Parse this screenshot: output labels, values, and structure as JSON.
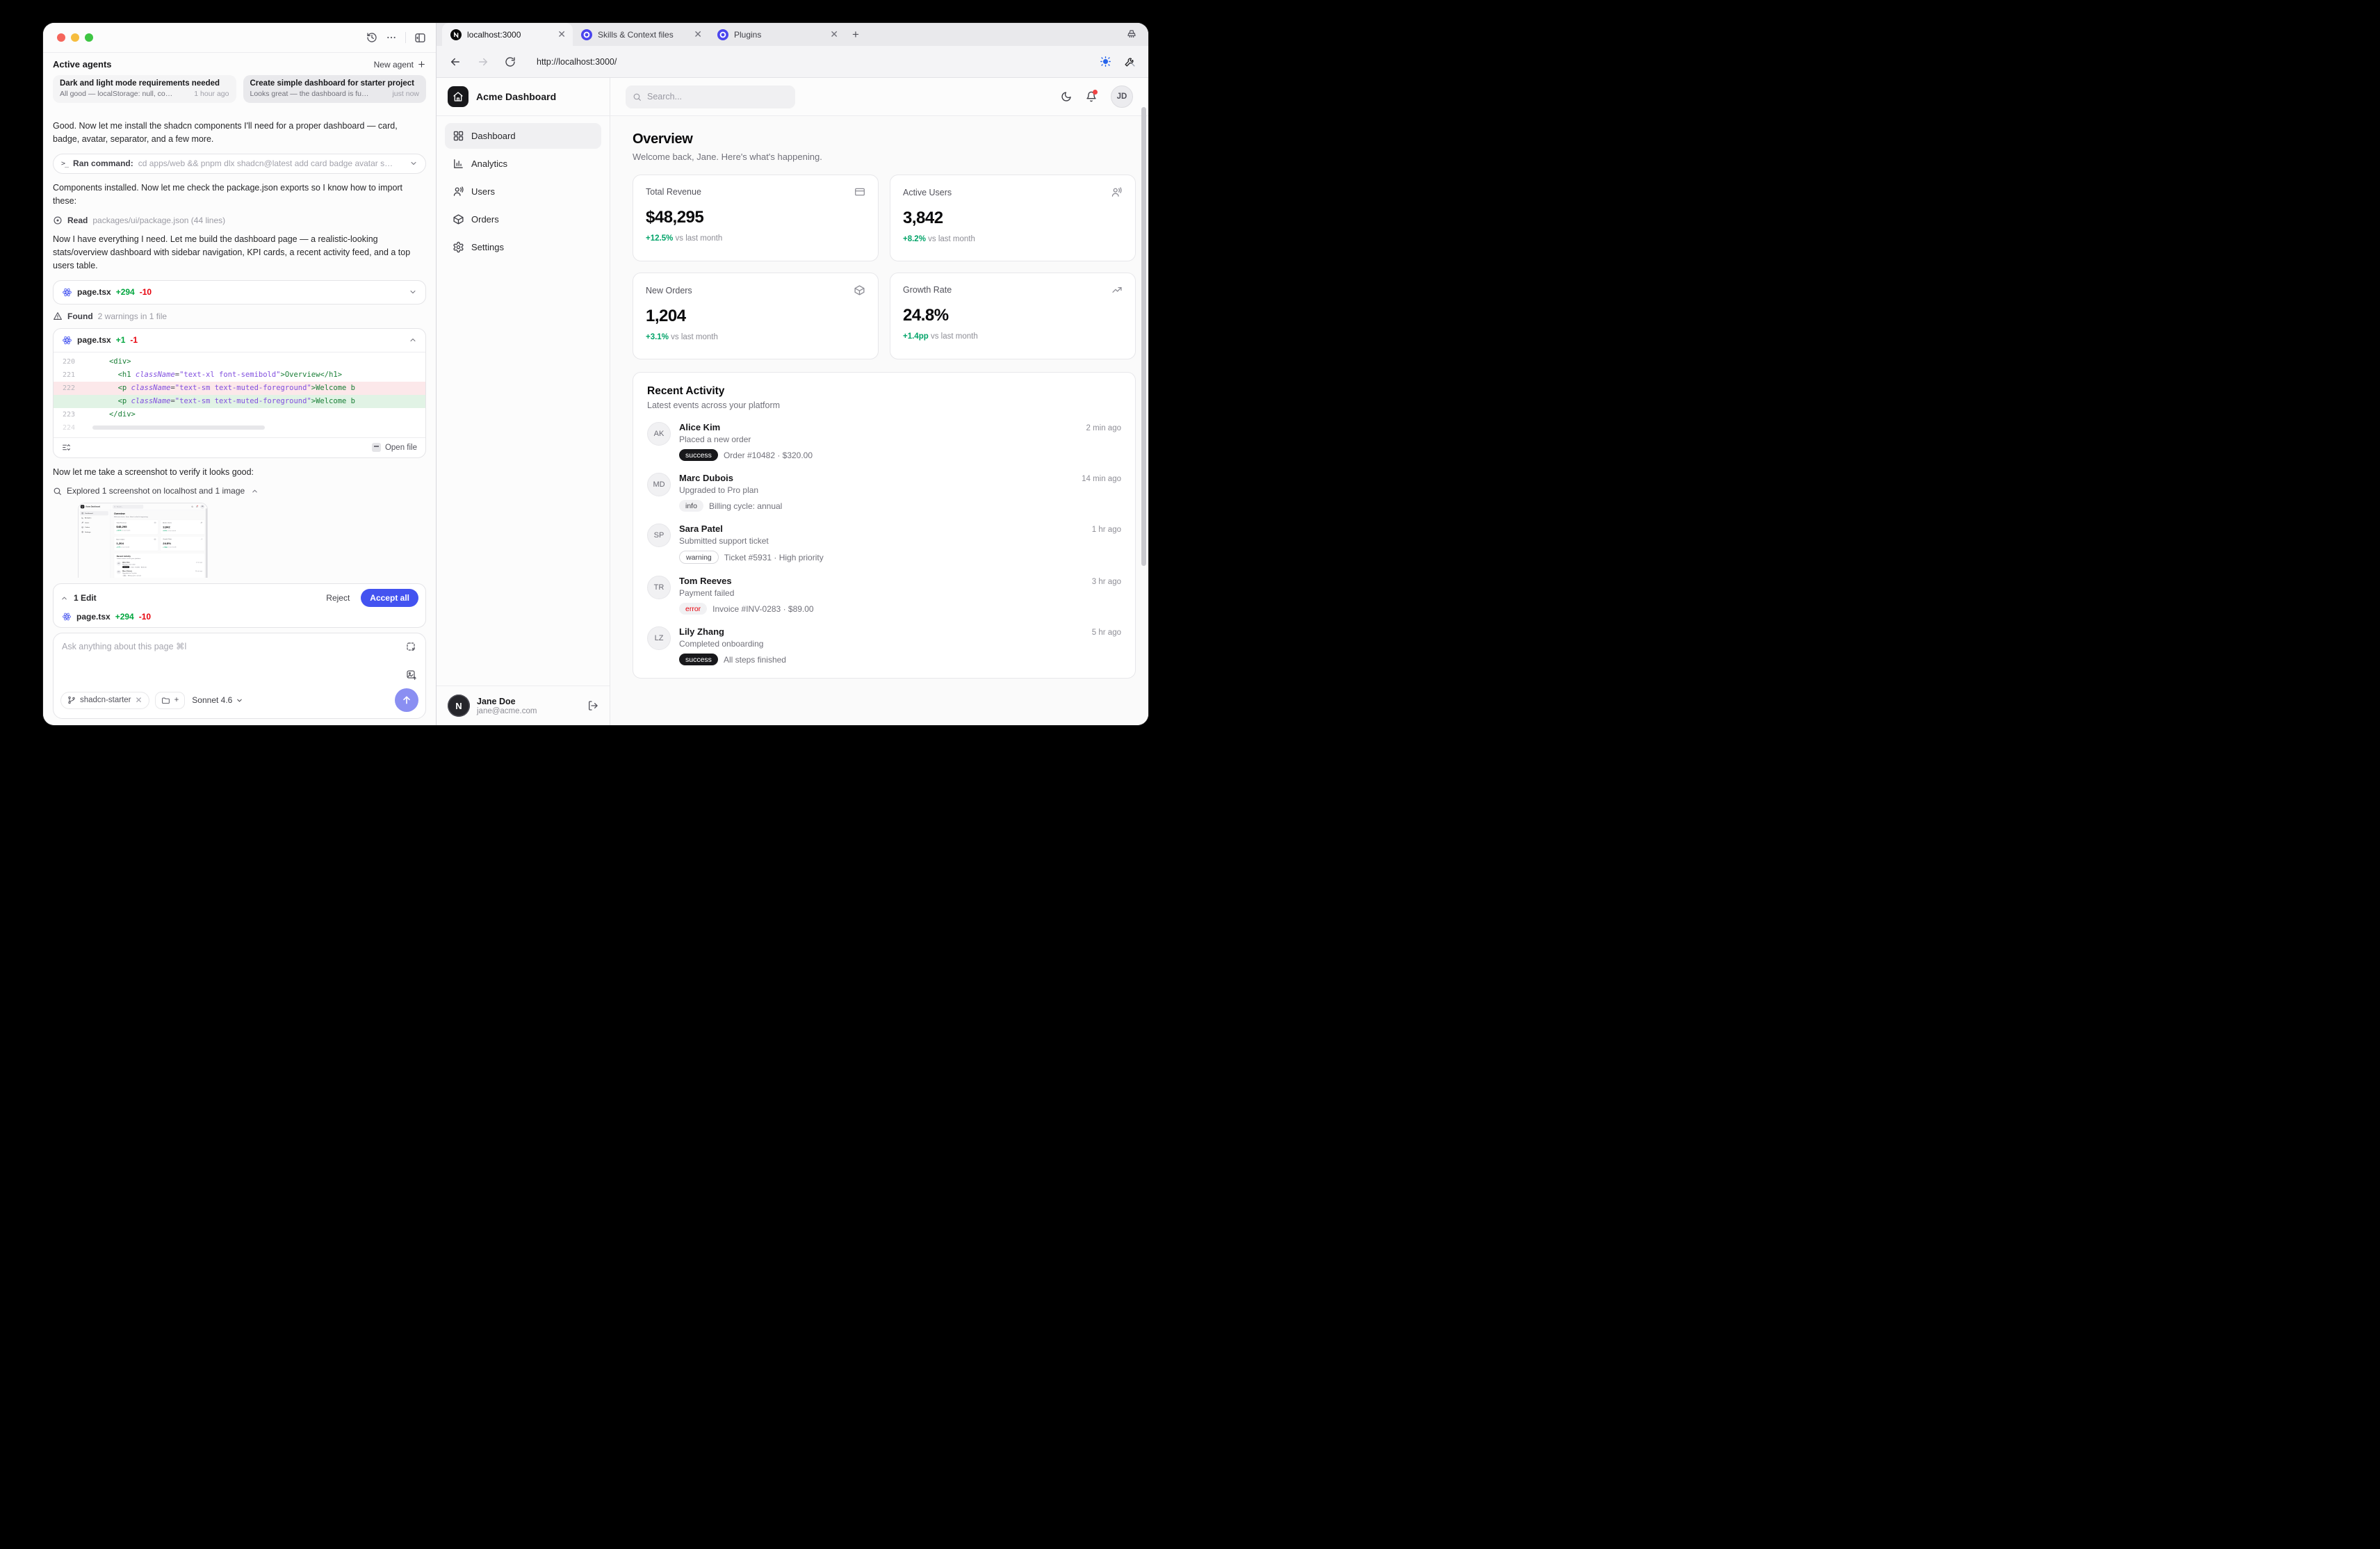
{
  "colors": {
    "accent_blue": "#4353f0",
    "positive_green": "#00a368",
    "diff_add_green": "#00a63e",
    "negative_red": "#e7000b",
    "send_periwinkle": "#8a8ff2",
    "favicon_indigo": "#4b45ee",
    "badge_dark": "#18181b"
  },
  "chat_panel": {
    "agents_header": {
      "title": "Active agents",
      "new_agent_label": "New agent",
      "plus": "+"
    },
    "agents": [
      {
        "title": "Dark and light mode requirements needed",
        "subtitle": "All good — localStorage: null, co…",
        "time": "1 hour ago",
        "state": ""
      },
      {
        "title": "Create simple dashboard for starter project",
        "subtitle": "Looks great — the dashboard is fu…",
        "time": "just now",
        "state": "selected"
      }
    ],
    "messages": {
      "m1": "Good. Now let me install the shadcn components I'll need for a proper dashboard — card, badge, avatar, separator, and a few more.",
      "m2": "Components installed. Now let me check the package.json exports so I know how to import these:",
      "m3": "Now I have everything I need. Let me build the dashboard page — a realistic-looking stats/overview dashboard with sidebar navigation, KPI cards, a recent activity feed, and a top users table.",
      "m4": "Now let me take a screenshot to verify it looks good:"
    },
    "ran_command": {
      "prompt": ">_",
      "label": "Ran command:",
      "command": "cd apps/web && pnpm dlx shadcn@latest add card badge avatar s…"
    },
    "read_row": {
      "label": "Read",
      "detail": "packages/ui/package.json (44 lines)"
    },
    "file_collapsed": {
      "name": "page.tsx",
      "added": "+294",
      "removed": "-10"
    },
    "warning_row": {
      "label": "Found",
      "detail": "2 warnings in 1 file"
    },
    "file_expanded": {
      "name": "page.tsx",
      "added": "+1",
      "removed": "-1",
      "open_file_label": "Open file"
    },
    "code_lines": [
      {
        "num": "220",
        "kind": "ctx",
        "segs": [
          {
            "t": "      ",
            "c": "pln"
          },
          {
            "t": "<div>",
            "c": "tag"
          }
        ]
      },
      {
        "num": "221",
        "kind": "ctx",
        "segs": [
          {
            "t": "        ",
            "c": "pln"
          },
          {
            "t": "<h1",
            "c": "tag"
          },
          {
            "t": " ",
            "c": "pln"
          },
          {
            "t": "className",
            "c": "attr"
          },
          {
            "t": "=",
            "c": "pln"
          },
          {
            "t": "\"text-xl font-semibold\"",
            "c": "str"
          },
          {
            "t": ">",
            "c": "tag"
          },
          {
            "t": "Overview",
            "c": "txt"
          },
          {
            "t": "</h1>",
            "c": "tag"
          }
        ]
      },
      {
        "num": "222",
        "kind": "del",
        "segs": [
          {
            "t": "        ",
            "c": "pln"
          },
          {
            "t": "<p",
            "c": "tag"
          },
          {
            "t": " ",
            "c": "pln"
          },
          {
            "t": "className",
            "c": "attr"
          },
          {
            "t": "=",
            "c": "pln"
          },
          {
            "t": "\"text-sm text-muted-foreground\"",
            "c": "str"
          },
          {
            "t": ">",
            "c": "tag"
          },
          {
            "t": "Welcome b",
            "c": "txt"
          }
        ]
      },
      {
        "num": "",
        "kind": "add",
        "segs": [
          {
            "t": "        ",
            "c": "pln"
          },
          {
            "t": "<p",
            "c": "tag"
          },
          {
            "t": " ",
            "c": "pln"
          },
          {
            "t": "className",
            "c": "attr"
          },
          {
            "t": "=",
            "c": "pln"
          },
          {
            "t": "\"text-sm text-muted-foreground\"",
            "c": "str"
          },
          {
            "t": ">",
            "c": "tag"
          },
          {
            "t": "Welcome b",
            "c": "txt"
          }
        ]
      },
      {
        "num": "223",
        "kind": "ctx",
        "segs": [
          {
            "t": "      ",
            "c": "pln"
          },
          {
            "t": "</div>",
            "c": "tag"
          }
        ]
      },
      {
        "num": "224",
        "kind": "dim",
        "segs": []
      }
    ],
    "explored_row": {
      "text": "Explored 1 screenshot on localhost and 1 image"
    },
    "edit_bar": {
      "count": "1 Edit",
      "reject_label": "Reject",
      "accept_label": "Accept all",
      "file": "page.tsx",
      "added": "+294",
      "removed": "-10"
    },
    "composer": {
      "placeholder": "Ask anything about this page ⌘l",
      "branch_chip": "shadcn-starter",
      "folder_plus": "+",
      "model": "Sonnet 4.6"
    }
  },
  "browser": {
    "tabs": [
      {
        "title": "localhost:3000",
        "favicon": "next",
        "state": "active"
      },
      {
        "title": "Skills & Context files",
        "favicon": "ring",
        "state": ""
      },
      {
        "title": "Plugins",
        "favicon": "ring",
        "state": ""
      }
    ],
    "new_tab": "+",
    "url": "http://localhost:3000/"
  },
  "dashboard": {
    "brand": "Acme Dashboard",
    "search_placeholder": "Search...",
    "topbar_avatar": "JD",
    "nav": [
      {
        "label": "Dashboard",
        "icon": "grid",
        "state": "active"
      },
      {
        "label": "Analytics",
        "icon": "chart",
        "state": ""
      },
      {
        "label": "Users",
        "icon": "users",
        "state": ""
      },
      {
        "label": "Orders",
        "icon": "package",
        "state": ""
      },
      {
        "label": "Settings",
        "icon": "gear",
        "state": ""
      }
    ],
    "page_title": "Overview",
    "page_subtitle": "Welcome back, Jane. Here's what's happening.",
    "kpis": [
      {
        "label": "Total Revenue",
        "value": "$48,295",
        "delta": "+12.5%",
        "suffix": " vs last month",
        "icon": "credit-card"
      },
      {
        "label": "Active Users",
        "value": "3,842",
        "delta": "+8.2%",
        "suffix": " vs last month",
        "icon": "users"
      },
      {
        "label": "New Orders",
        "value": "1,204",
        "delta": "+3.1%",
        "suffix": " vs last month",
        "icon": "package"
      },
      {
        "label": "Growth Rate",
        "value": "24.8%",
        "delta": "+1.4pp",
        "suffix": " vs last month",
        "icon": "trend"
      }
    ],
    "activity": {
      "title": "Recent Activity",
      "subtitle": "Latest events across your platform",
      "items": [
        {
          "initials": "AK",
          "name": "Alice Kim",
          "desc": "Placed a new order",
          "badge": "success",
          "style": "dark",
          "detail": "Order #10482 · $320.00",
          "time": "2 min ago"
        },
        {
          "initials": "MD",
          "name": "Marc Dubois",
          "desc": "Upgraded to Pro plan",
          "badge": "info",
          "style": "gray",
          "detail": "Billing cycle: annual",
          "time": "14 min ago"
        },
        {
          "initials": "SP",
          "name": "Sara Patel",
          "desc": "Submitted support ticket",
          "badge": "warning",
          "style": "outline",
          "detail": "Ticket #5931 · High priority",
          "time": "1 hr ago"
        },
        {
          "initials": "TR",
          "name": "Tom Reeves",
          "desc": "Payment failed",
          "badge": "error",
          "style": "red",
          "detail": "Invoice #INV-0283 · $89.00",
          "time": "3 hr ago"
        },
        {
          "initials": "LZ",
          "name": "Lily Zhang",
          "desc": "Completed onboarding",
          "badge": "success",
          "style": "dark",
          "detail": "All steps finished",
          "time": "5 hr ago"
        }
      ]
    },
    "user": {
      "name": "Jane Doe",
      "email": "jane@acme.com",
      "avatar_letter": "N"
    }
  }
}
